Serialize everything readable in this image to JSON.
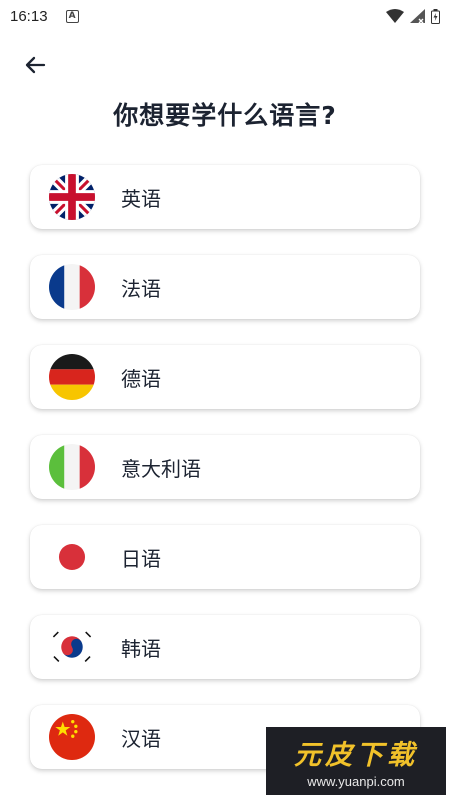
{
  "status_bar": {
    "time": "16:13",
    "notif_letter": "A"
  },
  "header": {
    "title": "你想要学什么语言?"
  },
  "languages": [
    {
      "label": "英语",
      "flag": "uk-flag-icon"
    },
    {
      "label": "法语",
      "flag": "france-flag-icon"
    },
    {
      "label": "德语",
      "flag": "germany-flag-icon"
    },
    {
      "label": "意大利语",
      "flag": "italy-flag-icon"
    },
    {
      "label": "日语",
      "flag": "japan-flag-icon"
    },
    {
      "label": "韩语",
      "flag": "korea-flag-icon"
    },
    {
      "label": "汉语",
      "flag": "china-flag-icon"
    }
  ],
  "watermark": {
    "title": "元皮下载",
    "url": "www.yuanpi.com"
  },
  "colors": {
    "text": "#1c2331",
    "card_bg": "#ffffff",
    "watermark_bg": "#1e1f25",
    "watermark_title": "#f2c22a"
  }
}
